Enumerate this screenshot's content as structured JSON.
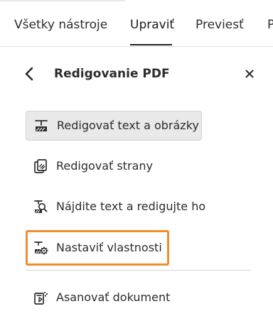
{
  "tabs": [
    {
      "label": "Všetky nástroje",
      "active": false
    },
    {
      "label": "Upraviť",
      "active": true
    },
    {
      "label": "Previesť",
      "active": false
    },
    {
      "label": "P",
      "active": false
    }
  ],
  "panel": {
    "title": "Redigovanie PDF",
    "back_icon": "chevron-left-icon",
    "close_icon": "close-icon"
  },
  "menu": {
    "items": [
      {
        "label": "Redigovať text a obrázky",
        "icon": "redact-text-image-icon",
        "state": "selected"
      },
      {
        "label": "Redigovať strany",
        "icon": "redact-pages-icon",
        "state": "normal"
      },
      {
        "label": "Nájdite text a redigujte ho",
        "icon": "find-redact-icon",
        "state": "normal"
      },
      {
        "label": "Nastaviť vlastnosti",
        "icon": "redaction-properties-icon",
        "state": "highlighted"
      }
    ],
    "footer_items": [
      {
        "label": "Asanovať dokument",
        "icon": "sanitize-document-icon",
        "state": "normal"
      }
    ]
  },
  "colors": {
    "highlight_border": "#f28d2e",
    "selected_background": "#e9e9e9",
    "active_tab_underline": "#222222"
  }
}
